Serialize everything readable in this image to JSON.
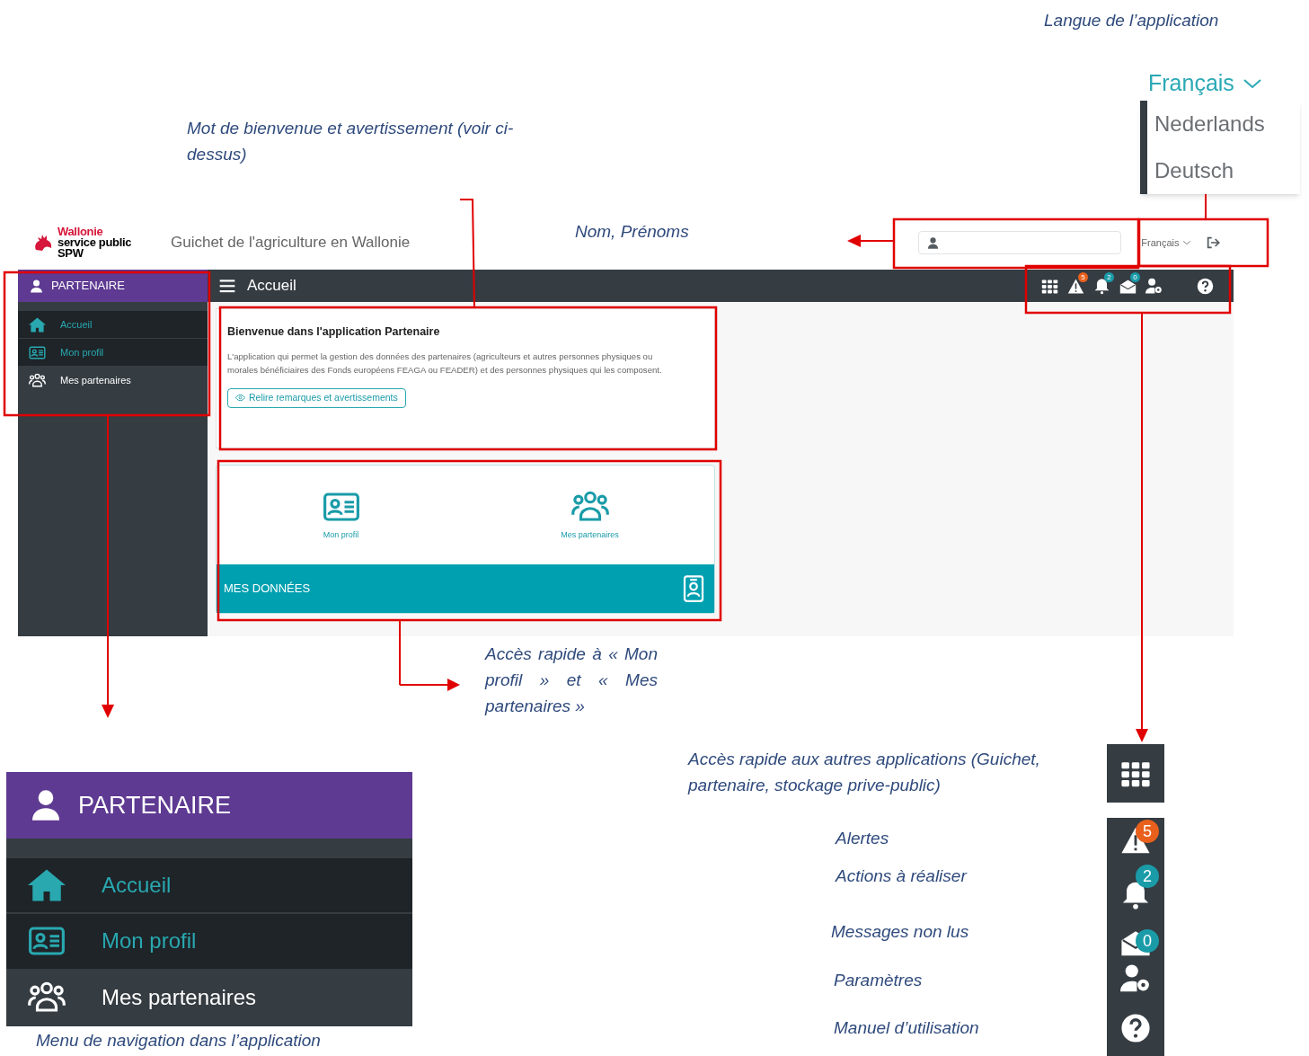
{
  "annotations": {
    "language": "Langue de l’application",
    "welcome": "Mot de bienvenue et avertissement (voir ci-dessus)",
    "name": "Nom, Prénoms",
    "quick_access": "Accès rapide à « Mon profil » et « Mes partenaires »",
    "navigation": "Menu de navigation dans l’application"
  },
  "language_menu": {
    "selected": "Français",
    "options": [
      "Nederlands",
      "Deutsch"
    ]
  },
  "app": {
    "logo": [
      "Wallonie",
      "service public",
      "SPW"
    ],
    "site_title": "Guichet de l'agriculture en Wallonie",
    "language": "Français",
    "toolbar_title": "Accueil",
    "toolbar_icons": [
      {
        "kind": "apps"
      },
      {
        "kind": "alerts",
        "badge": "5",
        "color": "#e8601c"
      },
      {
        "kind": "notifications",
        "badge": "2",
        "color": "#1a9ba8"
      },
      {
        "kind": "messages",
        "badge": "0",
        "color": "#1a9ba8"
      },
      {
        "kind": "settings"
      },
      {
        "kind": "help"
      }
    ],
    "sidebar": {
      "header": "PARTENAIRE",
      "items": [
        {
          "label": "Accueil",
          "highlighted": true
        },
        {
          "label": "Mon profil",
          "highlighted": true
        },
        {
          "label": "Mes partenaires",
          "highlighted": false
        }
      ]
    },
    "welcome": {
      "title": "Bienvenue dans l'application Partenaire",
      "body": "L'application qui permet la gestion des données des partenaires (agriculteurs et autres personnes physiques ou morales bénéficiaires des Fonds européens FEAGA ou FEADER) et des personnes physiques qui les composent.",
      "button": "Relire remarques et avertissements"
    },
    "quick_access": {
      "tiles": [
        {
          "label": "Mon profil"
        },
        {
          "label": "Mes partenaires"
        }
      ],
      "footer": "MES DONNÉES"
    }
  },
  "sidebar_zoom": {
    "header": "PARTENAIRE",
    "items": [
      {
        "label": "Accueil",
        "highlighted": true
      },
      {
        "label": "Mon profil",
        "highlighted": true
      },
      {
        "label": "Mes partenaires",
        "highlighted": false
      }
    ]
  },
  "icon_legend": [
    {
      "kind": "apps",
      "label": "Accès rapide aux autres applications (Guichet, partenaire, stockage prive-public)"
    },
    {
      "kind": "alerts",
      "label": "Alertes",
      "badge": "5",
      "color": "#e8601c"
    },
    {
      "kind": "notifications",
      "label": "Actions à réaliser",
      "badge": "2",
      "color": "#1a9ba8"
    },
    {
      "kind": "messages",
      "label": "Messages non lus",
      "badge": "0",
      "color": "#1a9ba8"
    },
    {
      "kind": "settings",
      "label": "Paramètres"
    },
    {
      "kind": "help",
      "label": "Manuel d’utilisation"
    }
  ]
}
